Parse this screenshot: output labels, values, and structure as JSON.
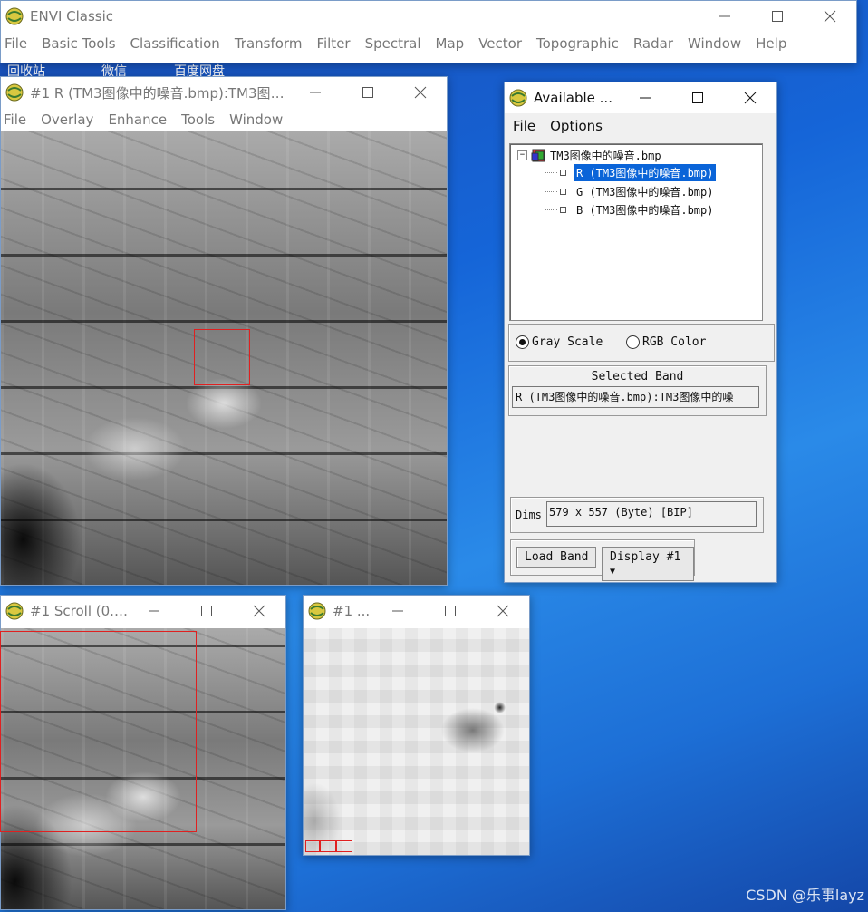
{
  "desktop": {
    "labels": [
      "回收站",
      "微信",
      "百度网盘"
    ],
    "watermark": "CSDN @乐事layz"
  },
  "envi_main": {
    "title": "ENVI Classic",
    "menu": [
      "File",
      "Basic Tools",
      "Classification",
      "Transform",
      "Filter",
      "Spectral",
      "Map",
      "Vector",
      "Topographic",
      "Radar",
      "Window",
      "Help"
    ]
  },
  "image_window": {
    "title": "#1 R (TM3图像中的噪音.bmp):TM3图像...",
    "menu": [
      "File",
      "Overlay",
      "Enhance",
      "Tools",
      "Window"
    ]
  },
  "scroll_window": {
    "title": "#1 Scroll (0.4..."
  },
  "zoom_window": {
    "title": "#1 ..."
  },
  "available_bands": {
    "title": "Available ...",
    "menu": [
      "File",
      "Options"
    ],
    "file_name": "TM3图像中的噪音.bmp",
    "bands": [
      "R (TM3图像中的噪音.bmp)",
      "G (TM3图像中的噪音.bmp)",
      "B (TM3图像中的噪音.bmp)"
    ],
    "selected_index": 0,
    "mode_gray": "Gray Scale",
    "mode_rgb": "RGB Color",
    "selected_mode": "gray",
    "selected_band_label": "Selected Band",
    "selected_band_value": "R (TM3图像中的噪音.bmp):TM3图像中的噪",
    "dims_label": "Dims",
    "dims_value": "579 x 557 (Byte) [BIP]",
    "load_band_label": "Load Band",
    "display_label": "Display #1"
  },
  "colors": {
    "selection_blue": "#0a64d8",
    "roi_red": "#e02020"
  }
}
